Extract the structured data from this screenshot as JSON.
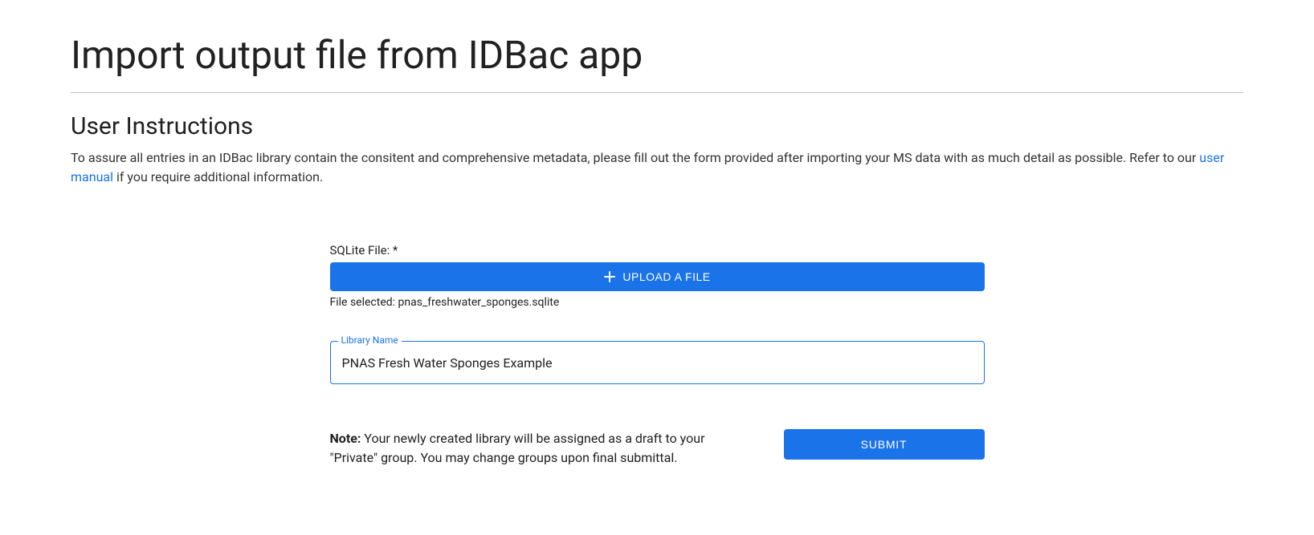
{
  "header": {
    "page_title": "Import output file from IDBac app"
  },
  "instructions": {
    "heading": "User Instructions",
    "text_before_link": "To assure all entries in an IDBac library contain the consitent and comprehensive metadata, please fill out the form provided after importing your MS data with as much detail as possible. Refer to our ",
    "link_text": "user manual",
    "text_after_link": " if you require additional information."
  },
  "form": {
    "sqlite_label": "SQLite File: *",
    "upload_button_label": "UPLOAD A FILE",
    "selected_file_prefix": "File selected: ",
    "selected_file_name": "pnas_freshwater_sponges.sqlite",
    "library_name_label": "Library Name",
    "library_name_value": "PNAS Fresh Water Sponges Example",
    "note_label": "Note:",
    "note_text": " Your newly created library will be assigned as a draft to your \"Private\" group. You may change groups upon final submittal.",
    "submit_label": "SUBMIT"
  }
}
